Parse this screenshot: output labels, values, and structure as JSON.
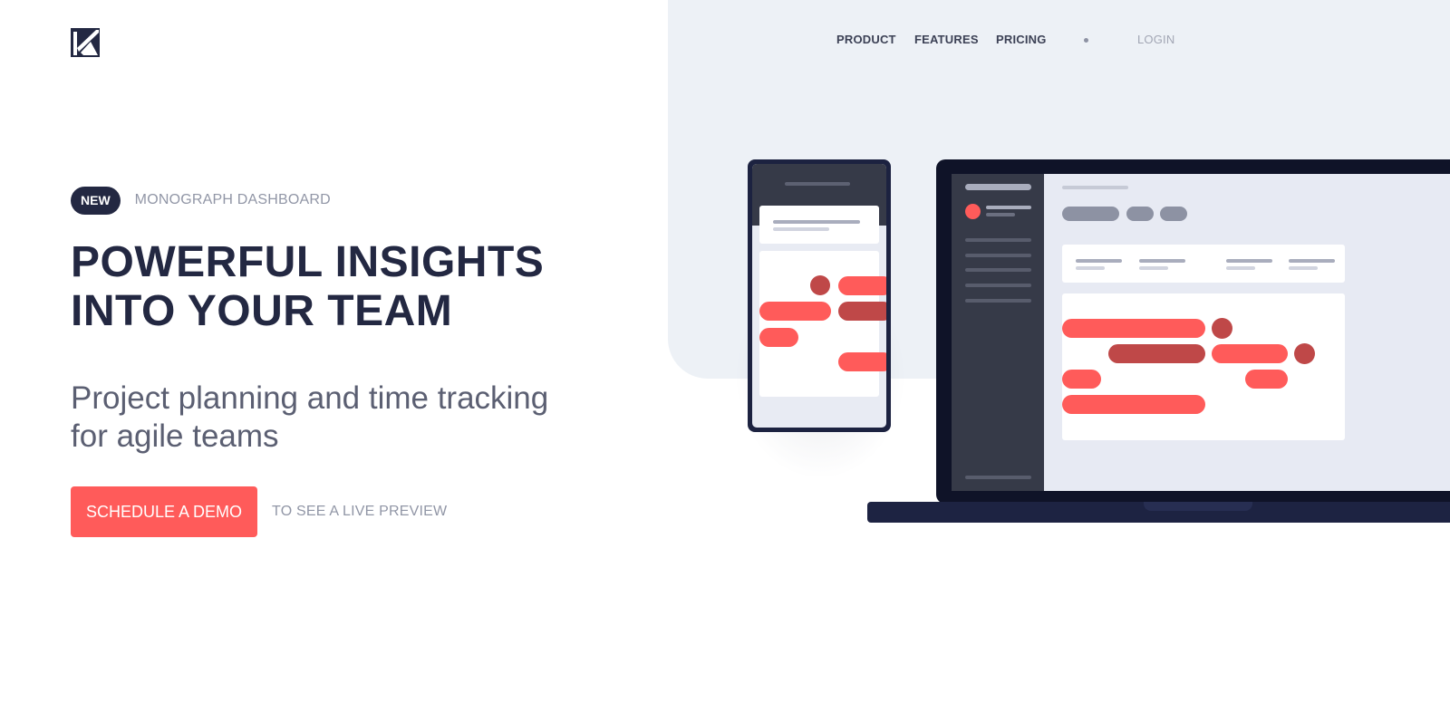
{
  "brand": {
    "logo_icon": "k-monogram-logo-icon"
  },
  "nav": {
    "items": [
      {
        "label": "PRODUCT"
      },
      {
        "label": "FEATURES"
      },
      {
        "label": "PRICING"
      }
    ],
    "login_label": "LOGIN"
  },
  "hero": {
    "badge": "NEW",
    "badge_caption": "MONOGRAPH DASHBOARD",
    "headline_line1": "POWERFUL INSIGHTS",
    "headline_line2": "INTO YOUR TEAM",
    "subtitle_line1": "Project planning and time tracking",
    "subtitle_line2": "for agile teams",
    "cta_label": "SCHEDULE A DEMO",
    "cta_note": "TO SEE A LIVE PREVIEW"
  },
  "colors": {
    "accent": "#ff5b5a",
    "accent_dark": "#bf4848",
    "navy": "#232842",
    "panel_bg": "#edf1f6",
    "muted_text": "#9196a6"
  },
  "illustration": {
    "phone": "phone-mockup-illustration",
    "laptop": "laptop-mockup-illustration"
  }
}
